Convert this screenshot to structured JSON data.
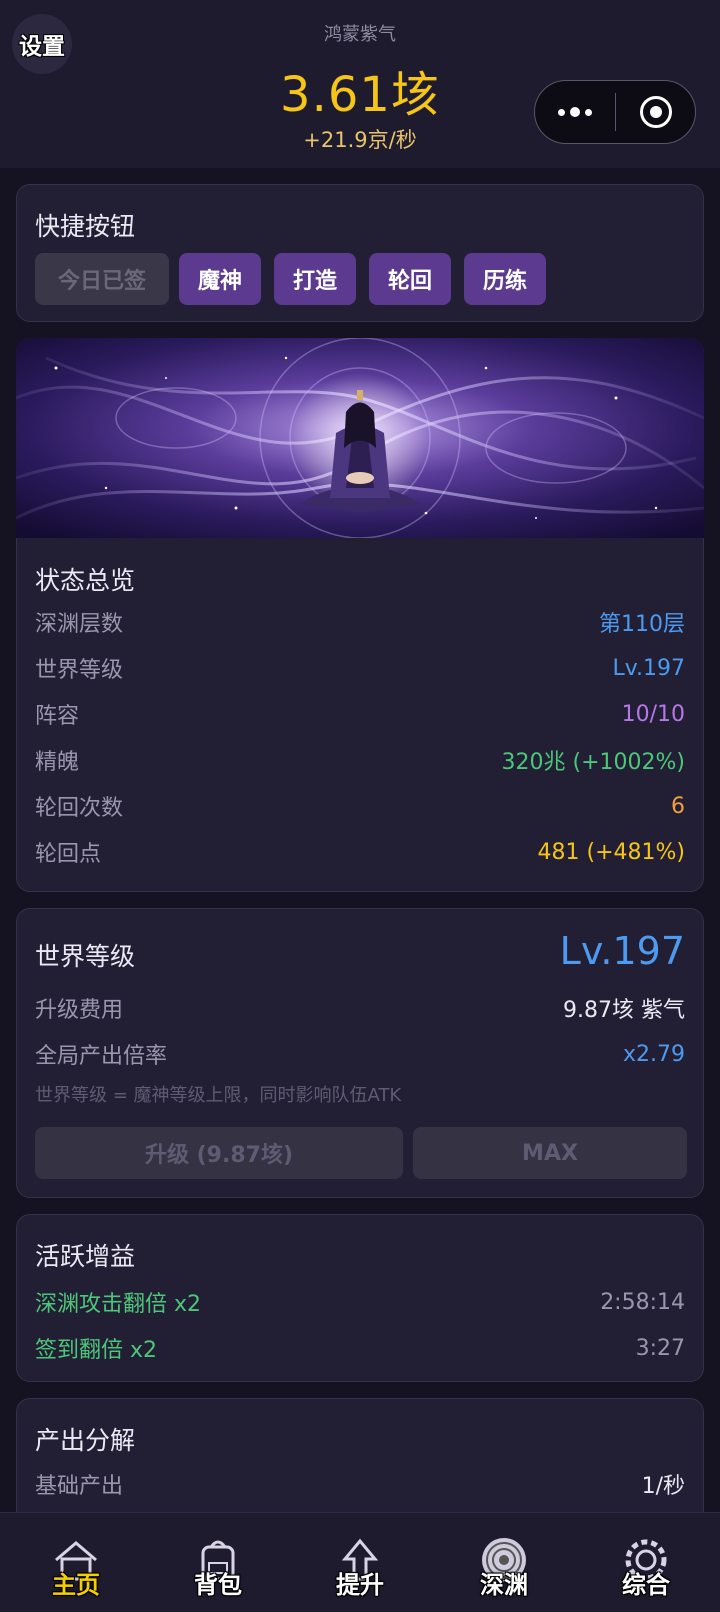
{
  "header": {
    "settings_label": "设置",
    "currency_name": "鸿蒙紫气",
    "currency_value": "3.61垓",
    "currency_rate": "+21.9京/秒"
  },
  "quick": {
    "title": "快捷按钮",
    "buttons": [
      {
        "label": "今日已签",
        "disabled": true
      },
      {
        "label": "魔神"
      },
      {
        "label": "打造"
      },
      {
        "label": "轮回"
      },
      {
        "label": "历练"
      }
    ]
  },
  "status": {
    "title": "状态总览",
    "rows": [
      {
        "label": "深渊层数",
        "value": "第110层",
        "color": "#4d9bf0"
      },
      {
        "label": "世界等级",
        "value": "Lv.197",
        "color": "#4d9bf0"
      },
      {
        "label": "阵容",
        "value": "10/10",
        "color": "#b678e8"
      },
      {
        "label": "精魄",
        "value": "320兆 (+1002%)",
        "color": "#4cc77a"
      },
      {
        "label": "轮回次数",
        "value": "6",
        "color": "#f0a040"
      },
      {
        "label": "轮回点",
        "value": "481 (+481%)",
        "color": "#f5c518"
      }
    ]
  },
  "world": {
    "title": "世界等级",
    "level": "Lv.197",
    "cost_label": "升级费用",
    "cost_value": "9.87垓 紫气",
    "mult_label": "全局产出倍率",
    "mult_value": "x2.79",
    "note": "世界等级 = 魔神等级上限，同时影响队伍ATK",
    "upgrade_button": "升级 (9.87垓)",
    "max_button": "MAX"
  },
  "buffs": {
    "title": "活跃增益",
    "items": [
      {
        "name": "深渊攻击翻倍 x2",
        "time": "2:58:14"
      },
      {
        "name": "签到翻倍 x2",
        "time": "3:27"
      }
    ]
  },
  "output": {
    "title": "产出分解",
    "base_label": "基础产出",
    "base_value": "1/秒"
  },
  "nav": {
    "items": [
      {
        "label": "主页",
        "icon": "home-icon",
        "active": true
      },
      {
        "label": "背包",
        "icon": "backpack-icon"
      },
      {
        "label": "提升",
        "icon": "arrow-up-icon"
      },
      {
        "label": "深渊",
        "icon": "vortex-icon"
      },
      {
        "label": "综合",
        "icon": "gear-icon"
      }
    ]
  },
  "colors": {
    "accent_gold": "#f5c518",
    "button_purple": "#5b3a90",
    "blue": "#4d9bf0",
    "green": "#4cc77a"
  }
}
